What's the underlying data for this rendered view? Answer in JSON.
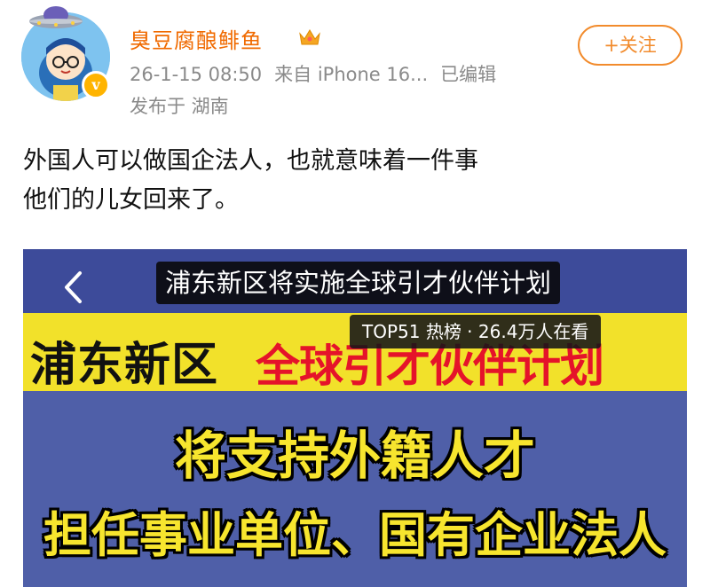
{
  "post": {
    "username": "臭豆腐酿鲱鱼",
    "timestamp": "26-1-15 08:50",
    "source": "来自 iPhone 16...",
    "edited": "已编辑",
    "location": "发布于 湖南",
    "follow_label": "+关注",
    "text_line1": "外国人可以做国企法人，也就意味着一件事",
    "text_line2": "他们的儿女回来了。"
  },
  "badges": {
    "verified_icon": "v-badge-icon",
    "vip_icon": "crown-icon",
    "avatar_ufo_icon": "ufo-icon"
  },
  "video": {
    "title": "浦东新区将实施全球引才伙伴计划",
    "trend": "TOP51 热榜 · 26.4万人在看",
    "band_black": "浦东新区",
    "band_red": "全球引才伙伴计划",
    "caption1": "将支持外籍人才",
    "caption2": "担任事业单位、国有企业法人"
  },
  "colors": {
    "username": "#f06a00",
    "follow": "#f28b2c",
    "video_bg": "#4f5fa8",
    "band_yellow": "#f2e12a",
    "band_red": "#e5132a",
    "caption_yellow": "#f7e52e"
  }
}
